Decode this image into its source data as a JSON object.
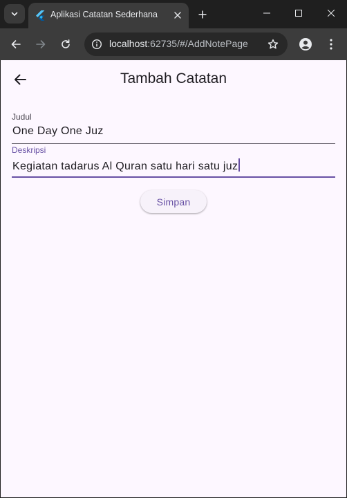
{
  "browser": {
    "tab": {
      "title": "Aplikasi Catatan Sederhana",
      "favicon": "flutter-icon"
    },
    "url": {
      "host": "localhost",
      "path": ":62735/#/AddNotePage"
    },
    "colors": {
      "frame": "#1f1f1f",
      "toolbar": "#3c3c3c",
      "omnibox": "#282828"
    }
  },
  "app": {
    "appbar": {
      "title": "Tambah Catatan",
      "back_icon": "arrow-back-icon"
    },
    "fields": {
      "judul": {
        "label": "Judul",
        "value": "One Day One Juz"
      },
      "deskripsi": {
        "label": "Deskripsi",
        "value": "Kegiatan tadarus Al Quran satu hari satu juz",
        "focused": true
      }
    },
    "save_button": {
      "label": "Simpan"
    },
    "colors": {
      "background": "#fdf7ff",
      "primary": "#6750a4",
      "outline": "#79747e",
      "text": "#1d1b20"
    }
  }
}
